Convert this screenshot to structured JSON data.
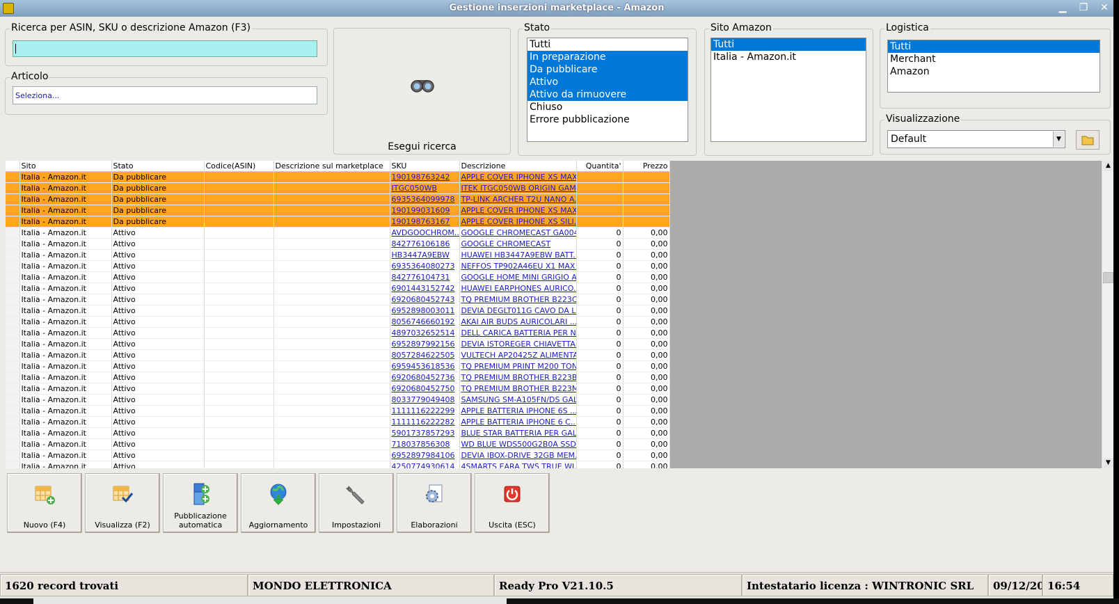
{
  "window": {
    "title": "Gestione inserzioni marketplace - Amazon",
    "min": "▁",
    "max": "❐",
    "close": "✕"
  },
  "search": {
    "legend": "Ricerca per ASIN, SKU o descrizione Amazon (F3)",
    "value": ""
  },
  "articolo": {
    "legend": "Articolo",
    "placeholder": "Seleziona..."
  },
  "search_button": {
    "label": "Esegui ricerca",
    "icon": "binoculars-icon"
  },
  "stato": {
    "legend": "Stato",
    "options": [
      {
        "label": "Tutti",
        "selected": false
      },
      {
        "label": "In preparazione",
        "selected": true
      },
      {
        "label": "Da pubblicare",
        "selected": true
      },
      {
        "label": "Attivo",
        "selected": true
      },
      {
        "label": "Attivo da rimuovere",
        "selected": true
      },
      {
        "label": "Chiuso",
        "selected": false
      },
      {
        "label": "Errore pubblicazione",
        "selected": false
      }
    ]
  },
  "sito": {
    "legend": "Sito Amazon",
    "options": [
      {
        "label": "Tutti",
        "selected": true
      },
      {
        "label": "Italia - Amazon.it",
        "selected": false
      }
    ]
  },
  "logistica": {
    "legend": "Logistica",
    "options": [
      {
        "label": "Tutti",
        "selected": true
      },
      {
        "label": "Merchant",
        "selected": false
      },
      {
        "label": "Amazon",
        "selected": false
      }
    ]
  },
  "visualizzazione": {
    "legend": "Visualizzazione",
    "value": "Default",
    "folder_icon": "folder-icon"
  },
  "colors": {
    "highlight_row": "#ffa51f",
    "selection": "#0078d7",
    "link": "#1a1ac8",
    "search_bg": "#a9f0f0"
  },
  "grid": {
    "columns": [
      "Sito",
      "Stato",
      "Codice(ASIN)",
      "Descrizione sul marketplace",
      "SKU",
      "Descrizione",
      "Quantita'",
      "Prezzo"
    ],
    "rows": [
      {
        "hl": true,
        "sito": "Italia - Amazon.it",
        "stato": "Da pubblicare",
        "asin": "",
        "desc_mkt": "",
        "sku": "190198763242",
        "descr": "APPLE COVER IPHONE XS MAX...",
        "qty": "",
        "price": ""
      },
      {
        "hl": true,
        "sito": "Italia - Amazon.it",
        "stato": "Da pubblicare",
        "asin": "",
        "desc_mkt": "",
        "sku": "ITGC050WB",
        "descr": "ITEK ITGC050WB ORIGIN GAM...",
        "qty": "",
        "price": ""
      },
      {
        "hl": true,
        "sito": "Italia - Amazon.it",
        "stato": "Da pubblicare",
        "asin": "",
        "desc_mkt": "",
        "sku": "6935364099978",
        "descr": "TP-LINK ARCHER T2U NANO A...",
        "qty": "",
        "price": ""
      },
      {
        "hl": true,
        "sito": "Italia - Amazon.it",
        "stato": "Da pubblicare",
        "asin": "",
        "desc_mkt": "",
        "sku": "190199031609",
        "descr": "APPLE COVER IPHONE XS MAX...",
        "qty": "",
        "price": ""
      },
      {
        "hl": true,
        "sito": "Italia - Amazon.it",
        "stato": "Da pubblicare",
        "asin": "",
        "desc_mkt": "",
        "sku": "190198763167",
        "descr": "APPLE COVER IPHONE XS SILI...",
        "qty": "",
        "price": ""
      },
      {
        "hl": false,
        "sito": "Italia - Amazon.it",
        "stato": "Attivo",
        "asin": "",
        "desc_mkt": "",
        "sku": "AVDGOOCHROM...",
        "descr": "GOOGLE CHROMECAST GA004...",
        "qty": "0",
        "price": "0,00"
      },
      {
        "hl": false,
        "sito": "Italia - Amazon.it",
        "stato": "Attivo",
        "asin": "",
        "desc_mkt": "",
        "sku": "842776106186",
        "descr": "GOOGLE CHROMECAST",
        "qty": "0",
        "price": "0,00"
      },
      {
        "hl": false,
        "sito": "Italia - Amazon.it",
        "stato": "Attivo",
        "asin": "",
        "desc_mkt": "",
        "sku": "HB3447A9EBW",
        "descr": "HUAWEI HB3447A9EBW BATT...",
        "qty": "0",
        "price": "0,00"
      },
      {
        "hl": false,
        "sito": "Italia - Amazon.it",
        "stato": "Attivo",
        "asin": "",
        "desc_mkt": "",
        "sku": "6935364080273",
        "descr": "NEFFOS TP902A46EU X1 MAX ...",
        "qty": "0",
        "price": "0,00"
      },
      {
        "hl": false,
        "sito": "Italia - Amazon.it",
        "stato": "Attivo",
        "asin": "",
        "desc_mkt": "",
        "sku": "842776104731",
        "descr": "GOOGLE HOME MINI GRIGIO A...",
        "qty": "0",
        "price": "0,00"
      },
      {
        "hl": false,
        "sito": "Italia - Amazon.it",
        "stato": "Attivo",
        "asin": "",
        "desc_mkt": "",
        "sku": "6901443152742",
        "descr": "HUAWEI EARPHONES AURICO...",
        "qty": "0",
        "price": "0,00"
      },
      {
        "hl": false,
        "sito": "Italia - Amazon.it",
        "stato": "Attivo",
        "asin": "",
        "desc_mkt": "",
        "sku": "6920680452743",
        "descr": "TQ PREMIUM BROTHER B223C...",
        "qty": "0",
        "price": "0,00"
      },
      {
        "hl": false,
        "sito": "Italia - Amazon.it",
        "stato": "Attivo",
        "asin": "",
        "desc_mkt": "",
        "sku": "6952898003011",
        "descr": "DEVIA DEGLT011G CAVO DA LI...",
        "qty": "0",
        "price": "0,00"
      },
      {
        "hl": false,
        "sito": "Italia - Amazon.it",
        "stato": "Attivo",
        "asin": "",
        "desc_mkt": "",
        "sku": "8056746660192",
        "descr": "AKAI AIR BUDS AURICOLARI ...",
        "qty": "0",
        "price": "0,00"
      },
      {
        "hl": false,
        "sito": "Italia - Amazon.it",
        "stato": "Attivo",
        "asin": "",
        "desc_mkt": "",
        "sku": "4897032652514",
        "descr": "DELL CARICA BATTERIA PER N...",
        "qty": "0",
        "price": "0,00"
      },
      {
        "hl": false,
        "sito": "Italia - Amazon.it",
        "stato": "Attivo",
        "asin": "",
        "desc_mkt": "",
        "sku": "6952897992156",
        "descr": "DEVIA ISTOREGER CHIAVETTA...",
        "qty": "0",
        "price": "0,00"
      },
      {
        "hl": false,
        "sito": "Italia - Amazon.it",
        "stato": "Attivo",
        "asin": "",
        "desc_mkt": "",
        "sku": "8057284622505",
        "descr": "VULTECH AP20425Z ALIMENTA...",
        "qty": "0",
        "price": "0,00"
      },
      {
        "hl": false,
        "sito": "Italia - Amazon.it",
        "stato": "Attivo",
        "asin": "",
        "desc_mkt": "",
        "sku": "6959453618536",
        "descr": "TQ PREMIUM PRINT M200 TON...",
        "qty": "0",
        "price": "0,00"
      },
      {
        "hl": false,
        "sito": "Italia - Amazon.it",
        "stato": "Attivo",
        "asin": "",
        "desc_mkt": "",
        "sku": "6920680452736",
        "descr": "TQ PREMIUM BROTHER B223B ...",
        "qty": "0",
        "price": "0,00"
      },
      {
        "hl": false,
        "sito": "Italia - Amazon.it",
        "stato": "Attivo",
        "asin": "",
        "desc_mkt": "",
        "sku": "6920680452750",
        "descr": "TQ PREMIUM BROTHER B223M...",
        "qty": "0",
        "price": "0,00"
      },
      {
        "hl": false,
        "sito": "Italia - Amazon.it",
        "stato": "Attivo",
        "asin": "",
        "desc_mkt": "",
        "sku": "8033779049408",
        "descr": "SAMSUNG SM-A105FN/DS GAL...",
        "qty": "0",
        "price": "0,00"
      },
      {
        "hl": false,
        "sito": "Italia - Amazon.it",
        "stato": "Attivo",
        "asin": "",
        "desc_mkt": "",
        "sku": "1111116222299",
        "descr": "APPLE BATTERIA IPHONE 6S ...",
        "qty": "0",
        "price": "0,00"
      },
      {
        "hl": false,
        "sito": "Italia - Amazon.it",
        "stato": "Attivo",
        "asin": "",
        "desc_mkt": "",
        "sku": "1111116222282",
        "descr": "APPLE BATTERIA IPHONE 6 C...",
        "qty": "0",
        "price": "0,00"
      },
      {
        "hl": false,
        "sito": "Italia - Amazon.it",
        "stato": "Attivo",
        "asin": "",
        "desc_mkt": "",
        "sku": "5901737857293",
        "descr": "BLUE STAR BATTERIA PER GAL...",
        "qty": "0",
        "price": "0,00"
      },
      {
        "hl": false,
        "sito": "Italia - Amazon.it",
        "stato": "Attivo",
        "asin": "",
        "desc_mkt": "",
        "sku": "718037856308",
        "descr": "WD BLUE WDS500G2B0A SSD ...",
        "qty": "0",
        "price": "0,00"
      },
      {
        "hl": false,
        "sito": "Italia - Amazon.it",
        "stato": "Attivo",
        "asin": "",
        "desc_mkt": "",
        "sku": "6952897984106",
        "descr": "DEVIA IBOX-DRIVE 32GB MEM...",
        "qty": "0",
        "price": "0,00"
      },
      {
        "hl": false,
        "sito": "Italia - Amazon.it",
        "stato": "Attivo",
        "asin": "",
        "desc_mkt": "",
        "sku": "4250774930614",
        "descr": "4SMARTS EARA TWS TRUE WI...",
        "qty": "0",
        "price": "0,00"
      }
    ]
  },
  "toolbar": [
    {
      "name": "nuovo-button",
      "icon": "grid-add-icon",
      "label": "Nuovo (F4)"
    },
    {
      "name": "visualizza-button",
      "icon": "grid-check-icon",
      "label": "Visualizza (F2)"
    },
    {
      "name": "pubblicazione-automatica-button",
      "icon": "publish-plus-icon",
      "label": "Pubblicazione automatica"
    },
    {
      "name": "aggiornamento-button",
      "icon": "globe-download-icon",
      "label": "Aggiornamento"
    },
    {
      "name": "impostazioni-button",
      "icon": "wrench-icon",
      "label": "Impostazioni"
    },
    {
      "name": "elaborazioni-button",
      "icon": "gear-document-icon",
      "label": "Elaborazioni"
    },
    {
      "name": "uscita-button",
      "icon": "power-icon",
      "label": "Uscita (ESC)"
    }
  ],
  "status": {
    "records": "1620 record trovati",
    "company": "MONDO ELETTRONICA",
    "version": "Ready Pro V21.10.5",
    "license": "Intestatario licenza : WINTRONIC SRL",
    "date": "09/12/20",
    "time": "16:54"
  }
}
